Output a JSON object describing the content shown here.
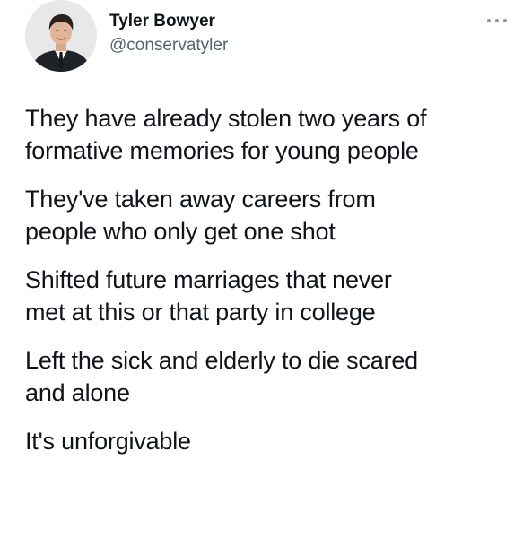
{
  "author": {
    "display_name": "Tyler Bowyer",
    "handle": "@conservatyler",
    "avatar_icon": "profile-photo"
  },
  "more_icon": "ellipsis-icon",
  "tweet": {
    "paragraphs": [
      "They have already stolen two years of\nformative memories for young people",
      "They've taken away careers from\npeople who only get one shot",
      "Shifted future marriages that never\nmet at this or that party in college",
      "Left the sick and elderly to die scared\nand alone",
      "It's unforgivable"
    ]
  },
  "colors": {
    "text": "#0f1419",
    "secondary": "#536471"
  }
}
